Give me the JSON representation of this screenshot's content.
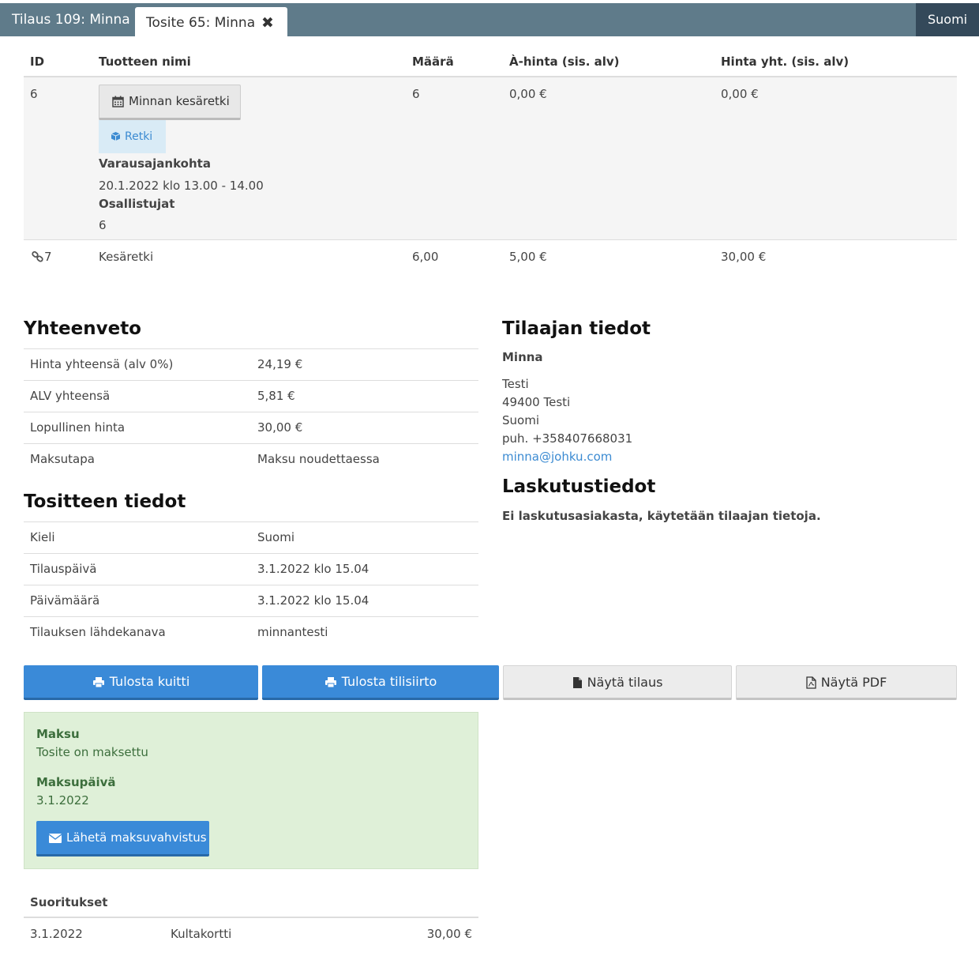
{
  "topbar": {
    "order_tab": "Tilaus 109: Minna",
    "active_tab": "Tosite 65: Minna",
    "language": "Suomi"
  },
  "products": {
    "headers": [
      "ID",
      "Tuotteen nimi",
      "Määrä",
      "À-hinta (sis. alv)",
      "Hinta yht. (sis. alv)"
    ],
    "row1": {
      "id": "6",
      "name": "Minnan kesäretki",
      "tag": "Retki",
      "time_label": "Varausajankohta",
      "time_value": "20.1.2022 klo 13.00 - 14.00",
      "participants_label": "Osallistujat",
      "participants_value": "6",
      "qty": "6",
      "unit_price": "0,00 €",
      "total": "0,00 €"
    },
    "row2": {
      "id": "7",
      "name": "Kesäretki",
      "qty": "6,00",
      "unit_price": "5,00 €",
      "total": "30,00 €"
    }
  },
  "summary": {
    "title": "Yhteenveto",
    "rows": [
      {
        "k": "Hinta yhteensä (alv 0%)",
        "v": "24,19 €"
      },
      {
        "k": "ALV yhteensä",
        "v": "5,81 €"
      },
      {
        "k": "Lopullinen hinta",
        "v": "30,00 €"
      },
      {
        "k": "Maksutapa",
        "v": "Maksu noudettaessa"
      }
    ]
  },
  "document": {
    "title": "Tositteen tiedot",
    "rows": [
      {
        "k": "Kieli",
        "v": "Suomi"
      },
      {
        "k": "Tilauspäivä",
        "v": "3.1.2022 klo 15.04"
      },
      {
        "k": "Päivämäärä",
        "v": "3.1.2022 klo 15.04"
      },
      {
        "k": "Tilauksen lähdekanava",
        "v": "minnantesti"
      }
    ]
  },
  "customer": {
    "title": "Tilaajan tiedot",
    "name": "Minna",
    "address1": "Testi",
    "address2": "49400 Testi",
    "country": "Suomi",
    "phone": "puh. +358407668031",
    "email": "minna@johku.com"
  },
  "billing": {
    "title": "Laskutustiedot",
    "text": "Ei laskutusasiakasta, käytetään tilaajan tietoja."
  },
  "actions": {
    "print_receipt": "Tulosta kuitti",
    "print_transfer": "Tulosta tilisiirto",
    "show_order": "Näytä tilaus",
    "show_pdf": "Näytä PDF"
  },
  "payment": {
    "label": "Maksu",
    "status": "Tosite on maksettu",
    "date_label": "Maksupäivä",
    "date": "3.1.2022",
    "send_button": "Lähetä maksuvahvistus"
  },
  "transactions": {
    "title": "Suoritukset",
    "rows": [
      {
        "date": "3.1.2022",
        "method": "Kultakortti",
        "amount": "30,00 €"
      }
    ]
  },
  "colors": {
    "topbar": "#5f7b8a",
    "accent_blue": "#3a8ad8",
    "success_bg": "#dff0d8"
  }
}
